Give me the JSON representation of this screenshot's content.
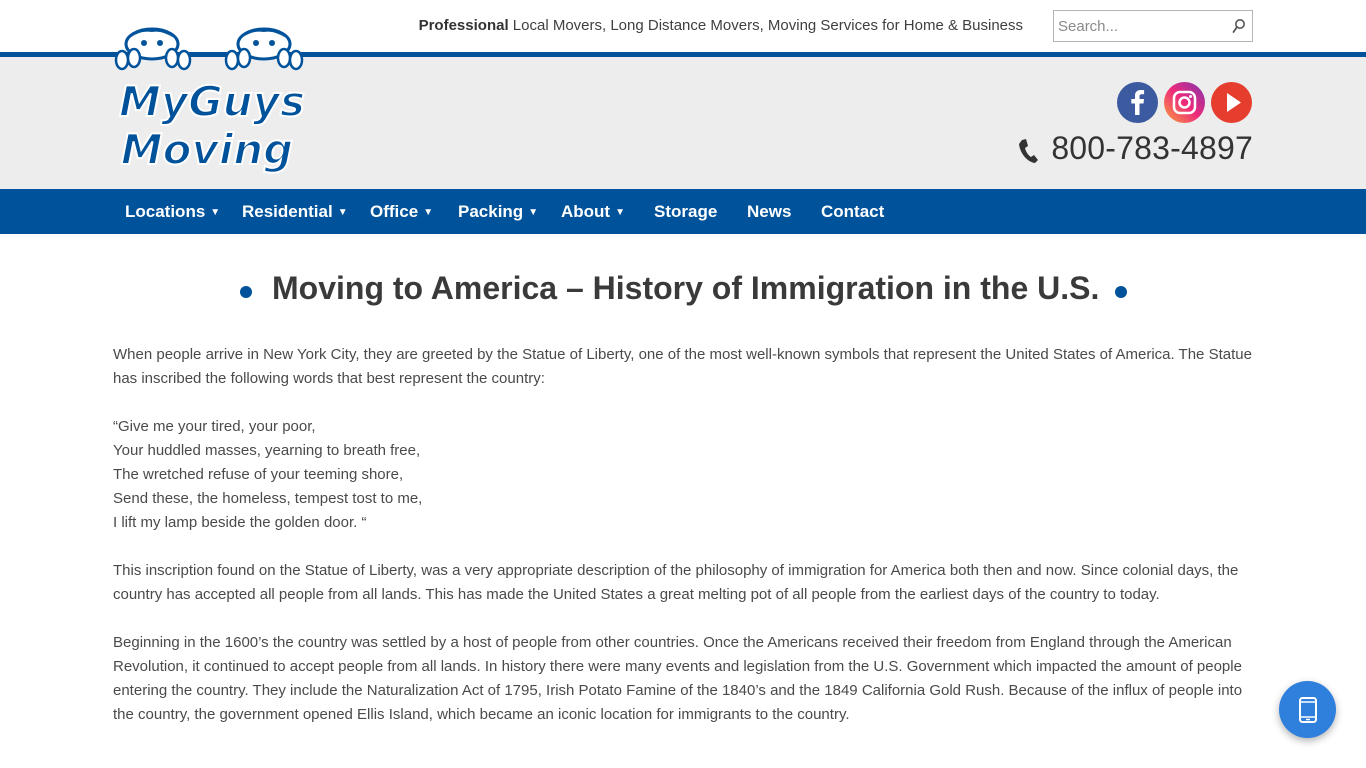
{
  "header": {
    "tagline_bold": "Professional",
    "tagline_rest": " Local Movers, Long Distance Movers, Moving Services for Home & Business",
    "search_placeholder": "Search...",
    "phone": "800-783-4897",
    "logo_text_line1": "MyGuys",
    "logo_text_line2": "Moving",
    "social": [
      "facebook-icon",
      "instagram-icon",
      "youtube-icon"
    ]
  },
  "nav": {
    "items": [
      {
        "label": "Locations",
        "dropdown": true
      },
      {
        "label": "Residential",
        "dropdown": true
      },
      {
        "label": "Office",
        "dropdown": true
      },
      {
        "label": "Packing",
        "dropdown": true
      },
      {
        "label": "About",
        "dropdown": true
      },
      {
        "label": "Storage",
        "dropdown": false
      },
      {
        "label": "News",
        "dropdown": false
      },
      {
        "label": "Contact",
        "dropdown": false
      }
    ]
  },
  "article": {
    "title": "Moving to America – History of Immigration in the U.S.",
    "p1": "When people arrive in New York City, they are greeted by the Statue of Liberty, one of the most well-known symbols that represent the United States of America. The Statue has inscribed the following words that best represent the country:",
    "poem": [
      "“Give me your tired, your poor,",
      "Your huddled masses, yearning to breath free,",
      "The wretched refuse of your teeming shore,",
      "Send these, the homeless, tempest tost to me,",
      "I lift my lamp beside the golden door. “"
    ],
    "p2": "This inscription found on the Statue of Liberty, was a very appropriate description of the philosophy of immigration for America both then and now. Since colonial days, the country has accepted all people from all lands. This has made the United States a great melting pot of all people from the earliest days of the country to today.",
    "p3": "Beginning in the 1600’s the country was settled by a host of people from other countries. Once the Americans received their freedom from England through the American Revolution, it continued to accept people from all lands. In history there were many events and legislation from the U.S. Government which impacted the amount of people entering the country. They include the Naturalization Act of 1795, Irish Potato Famine of the 1840’s and the 1849 California Gold Rush. Because of the influx of people into the country, the government opened Ellis Island, which became an iconic location for immigrants to the country."
  },
  "colors": {
    "brand_blue": "#00529b",
    "header_bg": "#ededed",
    "fab_blue": "#2f7fdc"
  }
}
